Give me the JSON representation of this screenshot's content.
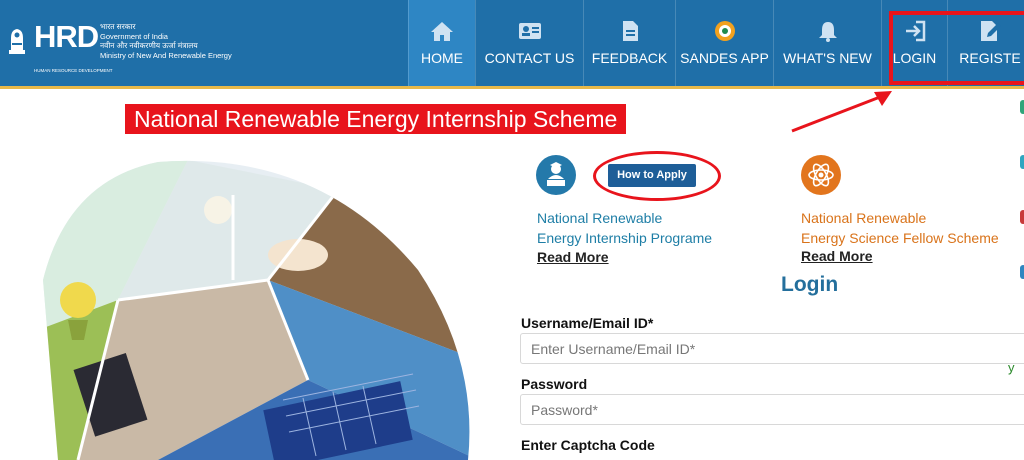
{
  "header": {
    "gov_lines": [
      "भारत सरकार",
      "Government of India",
      "नवीन और नवीकरणीय ऊर्जा मंत्रालय",
      "Ministry of New And Renewable Energy"
    ],
    "logo_text": "HRD",
    "logo_tagline": "HUMAN RESOURCE DEVELOPMENT",
    "nav": [
      {
        "label": "HOME",
        "icon": "home-icon"
      },
      {
        "label": "CONTACT US",
        "icon": "contact-card-icon"
      },
      {
        "label": "FEEDBACK",
        "icon": "document-icon"
      },
      {
        "label": "SANDES APP",
        "icon": "sandes-icon"
      },
      {
        "label": "WHAT'S NEW",
        "icon": "bell-icon"
      },
      {
        "label": "LOGIN",
        "icon": "login-icon"
      },
      {
        "label": "REGISTE",
        "icon": "register-icon"
      }
    ]
  },
  "banner": {
    "title": "National Renewable Energy Internship Scheme"
  },
  "schemes": {
    "how_to_apply": "How to Apply",
    "internship": {
      "line1": "National Renewable",
      "line2": "Energy Internship Programe",
      "read_more": "Read More"
    },
    "fellow": {
      "line1": "National Renewable",
      "line2": "Energy Science Fellow Scheme",
      "read_more": "Read More"
    }
  },
  "login": {
    "title": "Login",
    "username_label": "Username/Email ID*",
    "username_placeholder": "Enter Username/Email ID*",
    "password_label": "Password",
    "password_placeholder": "Password*",
    "captcha_label": "Enter Captcha Code"
  },
  "edge": {
    "letter": "y"
  },
  "colors": {
    "header": "#1f6fa8",
    "active_nav": "#2e86c4",
    "highlight": "#e8141c",
    "teal_text": "#1e7ea6",
    "orange_text": "#d9731a"
  }
}
